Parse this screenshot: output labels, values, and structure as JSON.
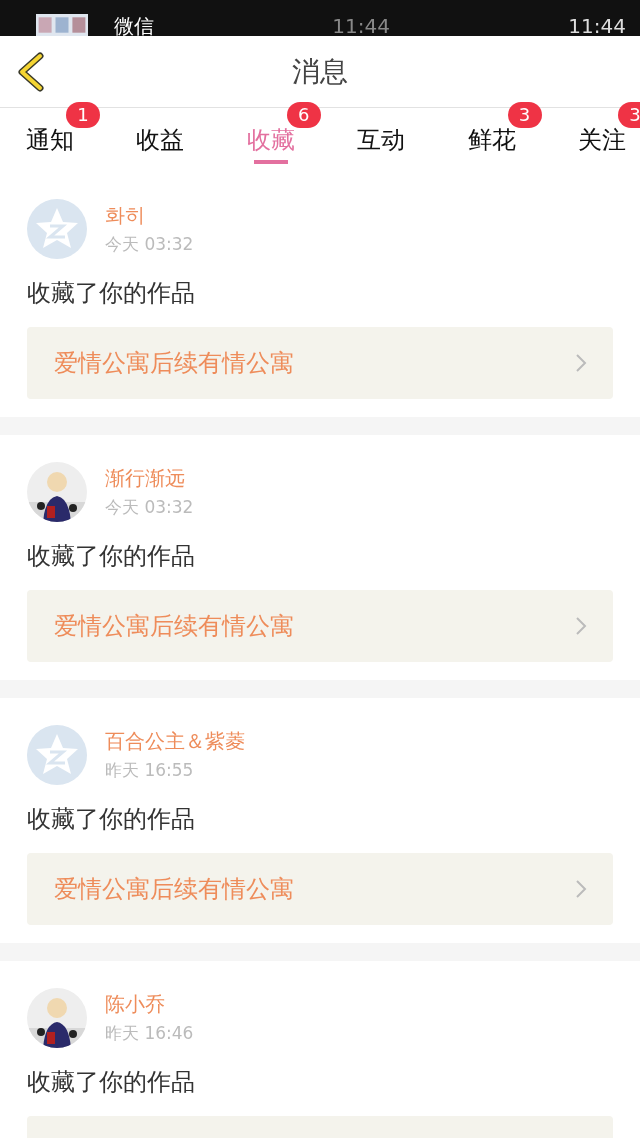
{
  "status_bar": {
    "clock": "11:44",
    "notification": {
      "app": "微信",
      "time": "11:44"
    }
  },
  "header": {
    "title": "消息"
  },
  "tabs": [
    {
      "label": "通知",
      "badge": "1",
      "selected": false
    },
    {
      "label": "收益",
      "selected": false
    },
    {
      "label": "收藏",
      "badge": "6",
      "selected": true
    },
    {
      "label": "互动",
      "selected": false
    },
    {
      "label": "鲜花",
      "badge": "3",
      "selected": false
    },
    {
      "label": "关注",
      "badge": "3",
      "selected": false
    }
  ],
  "messages": [
    {
      "name": "화히",
      "time": "今天 03:32",
      "kind": "default",
      "action": "收藏了你的作品",
      "work": "爱情公寓后续有情公寓"
    },
    {
      "name": "渐行渐远",
      "time": "今天 03:32",
      "kind": "picture",
      "action": "收藏了你的作品",
      "work": "爱情公寓后续有情公寓"
    },
    {
      "name": "百合公主＆紫菱",
      "time": "昨天 16:55",
      "kind": "default",
      "action": "收藏了你的作品",
      "work": "爱情公寓后续有情公寓"
    },
    {
      "name": "陈小乔",
      "time": "昨天 16:46",
      "kind": "picture",
      "action": "收藏了你的作品",
      "work_cut": true
    }
  ]
}
